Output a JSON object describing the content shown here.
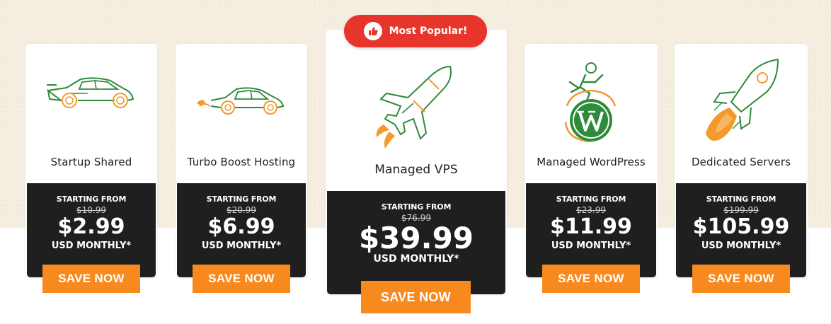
{
  "badge": {
    "label": "Most Popular!",
    "icon": "thumbs-up-icon"
  },
  "colors": {
    "accent": "#f7891f",
    "badge": "#e8352b",
    "dark": "#1f1f1f",
    "icon_green": "#2e8b3a",
    "icon_orange": "#f39a2c"
  },
  "plans": [
    {
      "name": "Startup Shared",
      "icon": "sports-car-icon",
      "starting": "STARTING FROM",
      "old_price": "$10.99",
      "price": "$2.99",
      "period": "USD MONTHLY*",
      "cta": "SAVE NOW"
    },
    {
      "name": "Turbo Boost Hosting",
      "icon": "turbo-car-icon",
      "starting": "STARTING FROM",
      "old_price": "$20.99",
      "price": "$6.99",
      "period": "USD MONTHLY*",
      "cta": "SAVE NOW"
    },
    {
      "name": "Managed VPS",
      "icon": "jet-icon",
      "starting": "STARTING FROM",
      "old_price": "$76.99",
      "price": "$39.99",
      "period": "USD MONTHLY*",
      "cta": "SAVE NOW"
    },
    {
      "name": "Managed WordPress",
      "icon": "wordpress-runner-icon",
      "starting": "STARTING FROM",
      "old_price": "$23.99",
      "price": "$11.99",
      "period": "USD MONTHLY*",
      "cta": "SAVE NOW"
    },
    {
      "name": "Dedicated Servers",
      "icon": "rocket-icon",
      "starting": "STARTING FROM",
      "old_price": "$199.99",
      "price": "$105.99",
      "period": "USD MONTHLY*",
      "cta": "SAVE NOW"
    }
  ]
}
